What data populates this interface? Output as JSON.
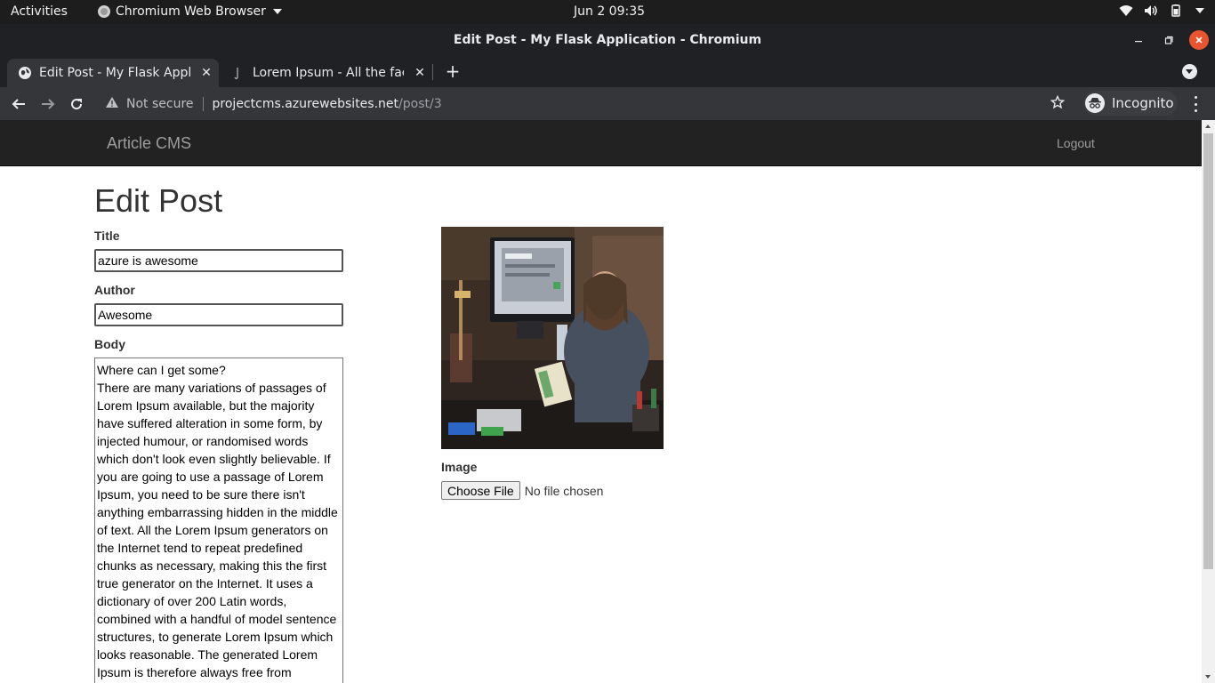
{
  "os_topbar": {
    "activities": "Activities",
    "app_name": "Chromium Web Browser",
    "clock": "Jun 2  09:35"
  },
  "window": {
    "title": "Edit Post - My Flask Application - Chromium"
  },
  "tabs": [
    {
      "label": "Edit Post - My Flask Applic",
      "active": true
    },
    {
      "label": "Lorem Ipsum - All the fact",
      "active": false
    }
  ],
  "omnibox": {
    "security": "Not secure",
    "host": "projectcms.azurewebsites.net",
    "path": "/post/3"
  },
  "profile": {
    "label": "Incognito"
  },
  "site_nav": {
    "brand": "Article CMS",
    "logout": "Logout"
  },
  "form": {
    "heading": "Edit Post",
    "title_label": "Title",
    "title_value": "azure is awesome",
    "author_label": "Author",
    "author_value": "Awesome",
    "body_label": "Body",
    "body_value": "Where can I get some?\nThere are many variations of passages of Lorem Ipsum available, but the majority have suffered alteration in some form, by injected humour, or randomised words which don't look even slightly believable. If you are going to use a passage of Lorem Ipsum, you need to be sure there isn't anything embarrassing hidden in the middle of text. All the Lorem Ipsum generators on the Internet tend to repeat predefined chunks as necessary, making this the first true generator on the Internet. It uses a dictionary of over 200 Latin words, combined with a handful of model sentence structures, to generate Lorem Ipsum which looks reasonable. The generated Lorem Ipsum is therefore always free from",
    "image_label": "Image",
    "choose_file": "Choose File",
    "no_file": "No file chosen"
  },
  "colors": {
    "navbar_bg": "#222222",
    "navbar_text": "#9d9d9d",
    "chrome_dark": "#202124",
    "chrome_toolbar": "#35363a",
    "close_button": "#e9542e"
  }
}
